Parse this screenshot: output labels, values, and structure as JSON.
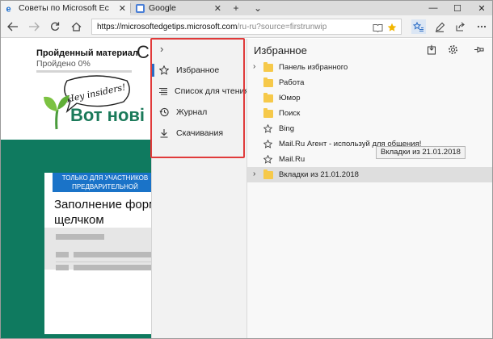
{
  "tabs": [
    {
      "title": "Советы по Microsoft Ec",
      "favicon": "edge-icon",
      "active": true
    },
    {
      "title": "Google",
      "favicon": "google-icon",
      "active": false
    }
  ],
  "new_tab_glyph": "+",
  "tab_list_glyph": "⌄",
  "window_controls": {
    "minimize": "—",
    "maximize": "☐",
    "close": "✕"
  },
  "address": {
    "host": "https://microsoftedgetips.microsoft.com",
    "path": "/ru-ru?source=firstrunwip"
  },
  "page": {
    "progress_title": "Пройденный материал",
    "progress_status": "Пройдено 0%",
    "progress_fraction": 0,
    "partial_heading": "С",
    "bubble_text": "Hey insiders!",
    "headline": "Вот нові",
    "card_banner_line1": "ТОЛЬКО ДЛЯ УЧАСТНИКОВ",
    "card_banner_line2": "ПРЕДВАРИТЕЛЬНОЙ",
    "card_heading_line1": "Заполнение форм",
    "card_heading_line2": "щелчком",
    "colors": {
      "accent_green": "#0f7a5f",
      "progress_fill": "#00b294",
      "banner_blue": "#1a73c8"
    }
  },
  "hub": {
    "collapse_glyph": "›",
    "items": [
      {
        "label": "Избранное",
        "icon": "star-icon",
        "selected": true
      },
      {
        "label": "Список для чтения",
        "icon": "reading-list-icon",
        "selected": false
      },
      {
        "label": "Журнал",
        "icon": "history-icon",
        "selected": false
      },
      {
        "label": "Скачивания",
        "icon": "download-icon",
        "selected": false
      }
    ],
    "highlight_color": "#e03a3a"
  },
  "favorites": {
    "title": "Избранное",
    "items": [
      {
        "label": "Панель избранного",
        "type": "folder",
        "expandable": true
      },
      {
        "label": "Работа",
        "type": "folder",
        "expandable": false
      },
      {
        "label": "Юмор",
        "type": "folder",
        "expandable": false
      },
      {
        "label": "Поиск",
        "type": "folder",
        "expandable": false
      },
      {
        "label": "Bing",
        "type": "link",
        "expandable": false
      },
      {
        "label": "Mail.Ru Агент - используй для общения!",
        "type": "link",
        "expandable": false
      },
      {
        "label": "Mail.Ru",
        "type": "link",
        "expandable": false
      },
      {
        "label": "Вкладки из 21.01.2018",
        "type": "folder",
        "expandable": true,
        "selected": true
      }
    ],
    "tooltip": "Вкладки из 21.01.2018"
  }
}
